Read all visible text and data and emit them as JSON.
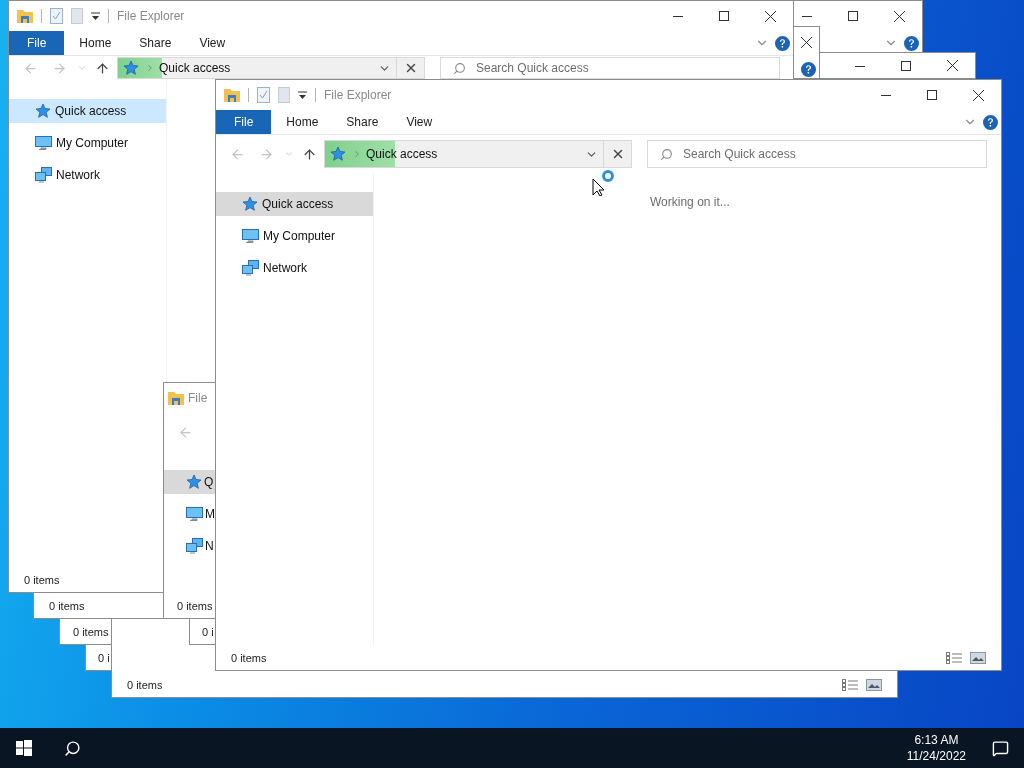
{
  "desktop": {
    "windows": [
      {
        "kind": "explorer",
        "title": "File Explorer",
        "tabs": [
          {
            "label": "File",
            "kind": "menu"
          },
          {
            "label": "Home",
            "kind": "tab"
          },
          {
            "label": "Share",
            "kind": "tab"
          },
          {
            "label": "View",
            "kind": "tab"
          }
        ],
        "address": {
          "location": "Quick access",
          "progress": {
            "level": 0.25
          }
        },
        "search": {
          "placeholder": "Search Quick access"
        },
        "nav": {
          "focused": false,
          "items": [
            {
              "label": "Quick access",
              "kind": "quick-access",
              "selected": true
            },
            {
              "label": "My Computer",
              "kind": "computer",
              "selected": false
            },
            {
              "label": "Network",
              "kind": "network",
              "selected": false
            }
          ]
        },
        "message": "Working on it...",
        "status": "0 items",
        "view_switcher": true,
        "busy": true
      },
      {
        "kind": "sliver",
        "title": "File",
        "nav": {
          "focused": false,
          "items": [
            {
              "label": "Q",
              "kind": "quick-access",
              "selected": true
            },
            {
              "label": "M",
              "kind": "computer",
              "selected": false
            },
            {
              "label": "N",
              "kind": "network",
              "selected": false
            }
          ]
        },
        "status": "0 items"
      },
      {
        "kind": "status",
        "status": "0 i"
      },
      {
        "kind": "status",
        "status": "0 items",
        "view_switcher": true
      },
      {
        "kind": "explorer",
        "title": "File Explorer",
        "tabs": [
          {
            "label": "File",
            "kind": "menu"
          },
          {
            "label": "Home",
            "kind": "tab"
          },
          {
            "label": "Share",
            "kind": "tab"
          },
          {
            "label": "View",
            "kind": "tab"
          }
        ],
        "address": {
          "location": "Quick access",
          "progress": {
            "level": 0.16
          }
        },
        "search": {
          "placeholder": "Search Quick access"
        },
        "nav": {
          "focused": true,
          "items": [
            {
              "label": "Quick access",
              "kind": "quick-access",
              "selected": true
            },
            {
              "label": "My Computer",
              "kind": "computer",
              "selected": false
            },
            {
              "label": "Network",
              "kind": "network",
              "selected": false
            }
          ]
        },
        "status": "0 items"
      },
      {
        "kind": "status",
        "status": "0 items"
      },
      {
        "kind": "status",
        "status": "0 items"
      },
      {
        "kind": "status",
        "status": "0 i"
      },
      {
        "kind": "caption"
      },
      {
        "kind": "caption"
      },
      {
        "kind": "caption"
      }
    ]
  },
  "taskbar": {
    "time": "6:13 AM",
    "date": "11/24/2022"
  }
}
